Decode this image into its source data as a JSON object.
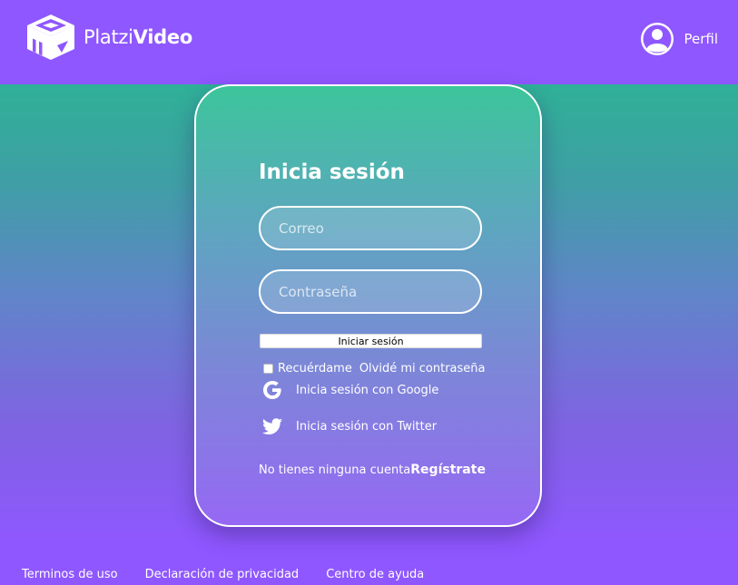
{
  "header": {
    "brand": {
      "logo_icon": "platzi-video-cube-logo",
      "name_regular": "Platzi",
      "name_bold": "Video"
    },
    "profile": {
      "icon": "user-avatar-icon",
      "label": "Perfil"
    },
    "background_color": "#8f57ff"
  },
  "login": {
    "title": "Inicia sesión",
    "email_placeholder": "Correo",
    "password_placeholder": "Contraseña",
    "submit_label": "Iniciar sesión",
    "remember_label": "Recuérdame",
    "remember_checked": false,
    "forgot_label": "Olvidé mi contraseña",
    "google": {
      "icon": "google-icon",
      "label": "Inicia sesión con Google"
    },
    "twitter": {
      "icon": "twitter-icon",
      "label": "Inicia sesión con Twitter"
    },
    "register_prompt": "No tienes ninguna cuenta",
    "register_link": "Regístrate"
  },
  "footer": {
    "links": [
      "Terminos de uso",
      "Declaración de privacidad",
      "Centro de ayuda"
    ]
  },
  "colors": {
    "accent_purple": "#8f57ff",
    "accent_green": "#21c08b",
    "text": "#ffffff"
  }
}
